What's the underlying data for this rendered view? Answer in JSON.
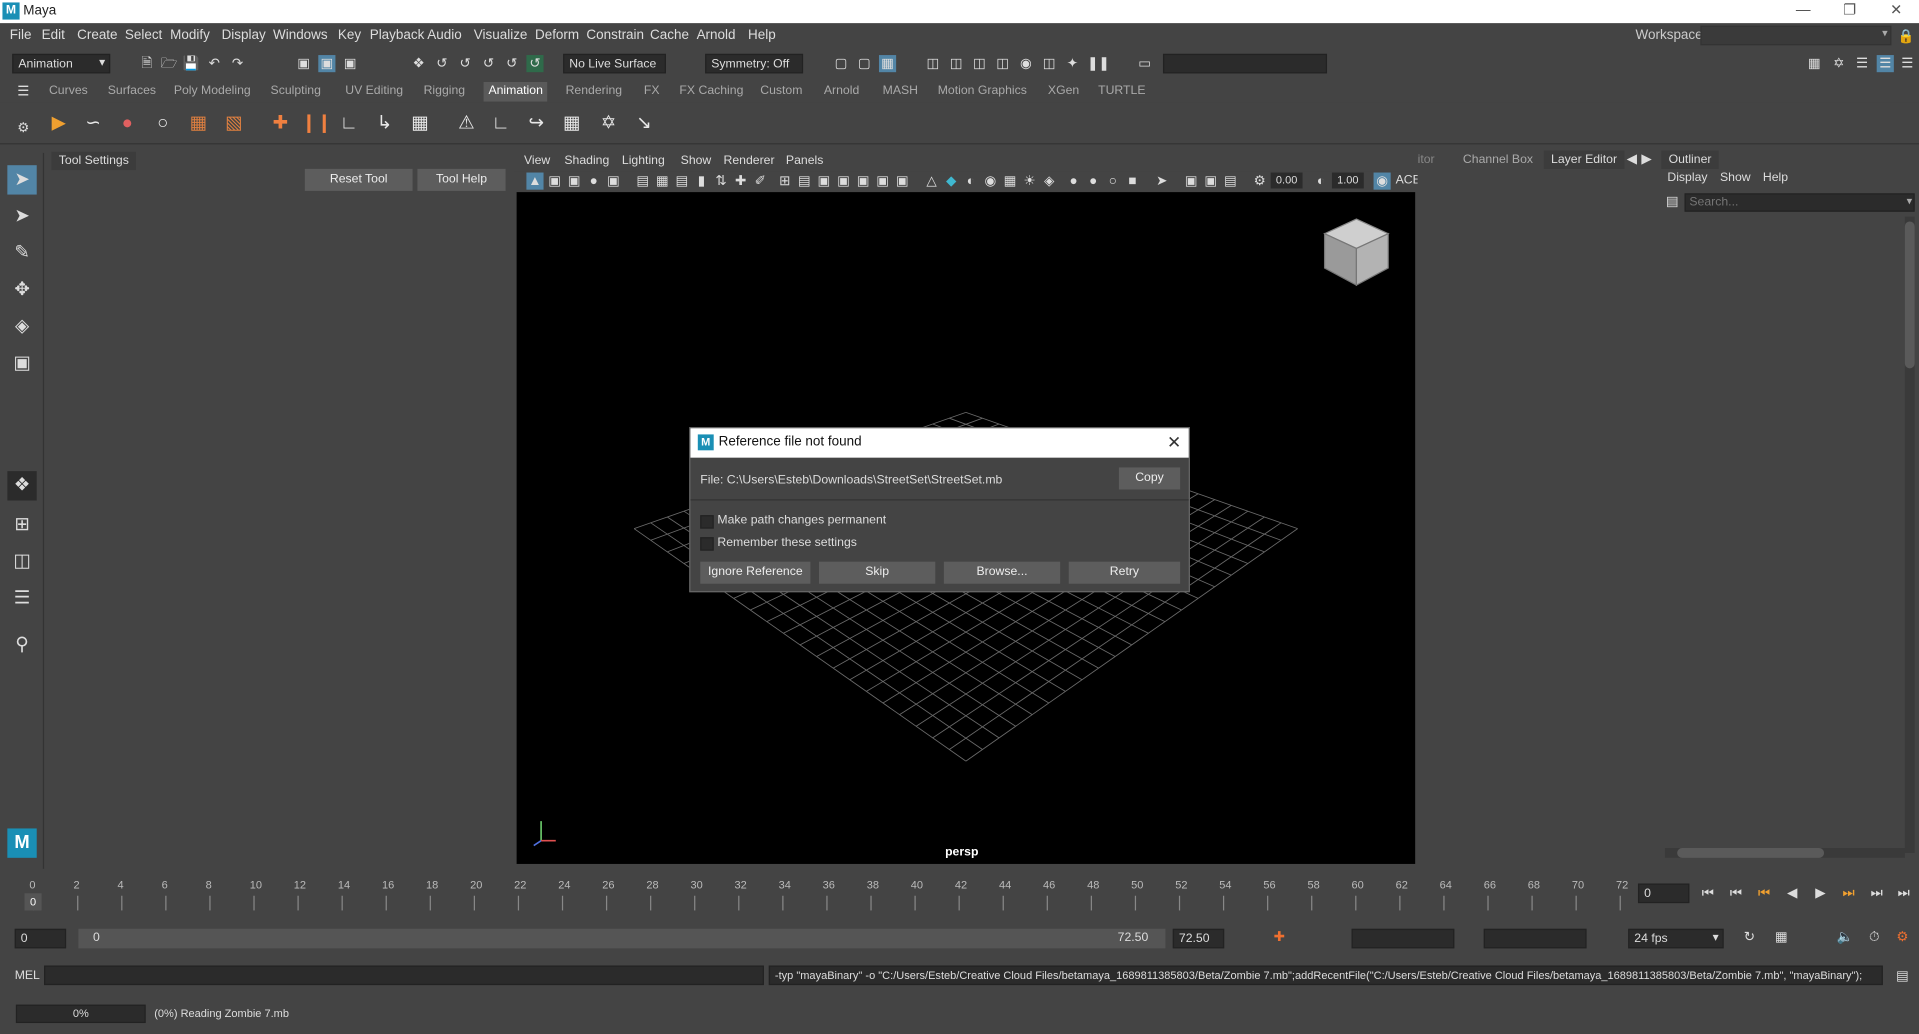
{
  "app": {
    "title": "Maya",
    "logo_letter": "M"
  },
  "menubar": {
    "items": [
      "File",
      "Edit",
      "Create",
      "Select",
      "Modify",
      "Display",
      "Windows",
      "Key",
      "Playback",
      "Audio",
      "Visualize",
      "Deform",
      "Constrain",
      "Cache",
      "Arnold",
      "Help"
    ],
    "workspace_label": "Workspace:"
  },
  "statusline": {
    "menu_set": "Animation",
    "live_surface": "No Live Surface",
    "symmetry": "Symmetry: Off"
  },
  "shelf": {
    "tabs": [
      "Curves",
      "Surfaces",
      "Poly Modeling",
      "Sculpting",
      "UV Editing",
      "Rigging",
      "Animation",
      "Rendering",
      "FX",
      "FX Caching",
      "Custom",
      "Arnold",
      "MASH",
      "Motion Graphics",
      "XGen",
      "TURTLE"
    ],
    "active_tab": "Animation"
  },
  "tool_settings": {
    "tab": "Tool Settings",
    "reset_label": "Reset Tool",
    "help_label": "Tool Help"
  },
  "viewport": {
    "menus": [
      "View",
      "Shading",
      "Lighting",
      "Show",
      "Renderer",
      "Panels"
    ],
    "field_a": "0.00",
    "field_b": "1.00",
    "aces": "ACE",
    "camera_label": "persp"
  },
  "right_panel": {
    "tabs": [
      "itor",
      "Channel Box",
      "Layer Editor"
    ]
  },
  "outliner": {
    "title": "Outliner",
    "menus": [
      "Display",
      "Show",
      "Help"
    ],
    "search_placeholder": "Search..."
  },
  "dialog": {
    "title": "Reference file not found",
    "file_line": "File: C:\\Users\\Esteb\\Downloads\\StreetSet\\StreetSet.mb",
    "copy_label": "Copy",
    "check_permanent": "Make path changes permanent",
    "check_remember": "Remember these settings",
    "btn_ignore": "Ignore Reference",
    "btn_skip": "Skip",
    "btn_browse": "Browse...",
    "btn_retry": "Retry"
  },
  "timeline": {
    "ticks": [
      "0",
      "2",
      "4",
      "6",
      "8",
      "10",
      "12",
      "14",
      "16",
      "18",
      "20",
      "22",
      "24",
      "26",
      "28",
      "30",
      "32",
      "34",
      "36",
      "38",
      "40",
      "42",
      "44",
      "46",
      "48",
      "50",
      "52",
      "54",
      "56",
      "58",
      "60",
      "62",
      "64",
      "66",
      "68",
      "70",
      "72"
    ],
    "current_marker": "0",
    "current_frame": "0"
  },
  "range": {
    "start": "0",
    "inner_start": "0",
    "inner_end": "72.50",
    "end": "72.50",
    "fps": "24 fps"
  },
  "cmdline": {
    "lang": "MEL",
    "output": "-typ \"mayaBinary\" -o \"C:/Users/Esteb/Creative Cloud Files/betamaya_1689811385803/Beta/Zombie 7.mb\";addRecentFile(\"C:/Users/Esteb/Creative Cloud Files/betamaya_1689811385803/Beta/Zombie 7.mb\", \"mayaBinary\");"
  },
  "helpline": {
    "progress_text": "0%",
    "progress": 0,
    "message": "(0%) Reading Zombie 7.mb"
  }
}
